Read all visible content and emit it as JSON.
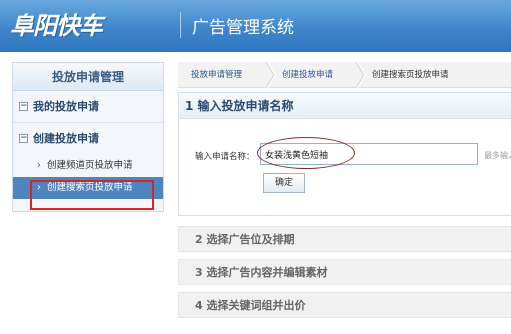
{
  "header": {
    "logo_text": "阜阳快车",
    "system_title": "广告管理系统"
  },
  "sidebar": {
    "title": "投放申请管理",
    "groups": [
      {
        "label": "我的投放申请",
        "icon": "minus-box-icon"
      },
      {
        "label": "创建投放申请",
        "icon": "minus-box-icon"
      }
    ],
    "sub_items": [
      {
        "label": "创建频道页投放申请",
        "active": false
      },
      {
        "label": "创建搜索页投放申请",
        "active": true
      }
    ]
  },
  "breadcrumb": [
    "投放申请管理",
    "创建投放申请",
    "创建搜索页投放申请"
  ],
  "step1": {
    "title": "1 输入投放申请名称",
    "field_label": "输入申请名称：",
    "input_value": "女装浅黄色短袖",
    "hint": "最多输入",
    "confirm_label": "确定"
  },
  "steps": [
    {
      "label": "2 选择广告位及排期"
    },
    {
      "label": "3 选择广告内容并编辑素材"
    },
    {
      "label": "4 选择关键词组并出价"
    }
  ],
  "colors": {
    "header_blue": "#3f86cc",
    "active_item": "#4f85be",
    "highlight_red": "#d32626",
    "link_blue": "#2d5b91"
  }
}
